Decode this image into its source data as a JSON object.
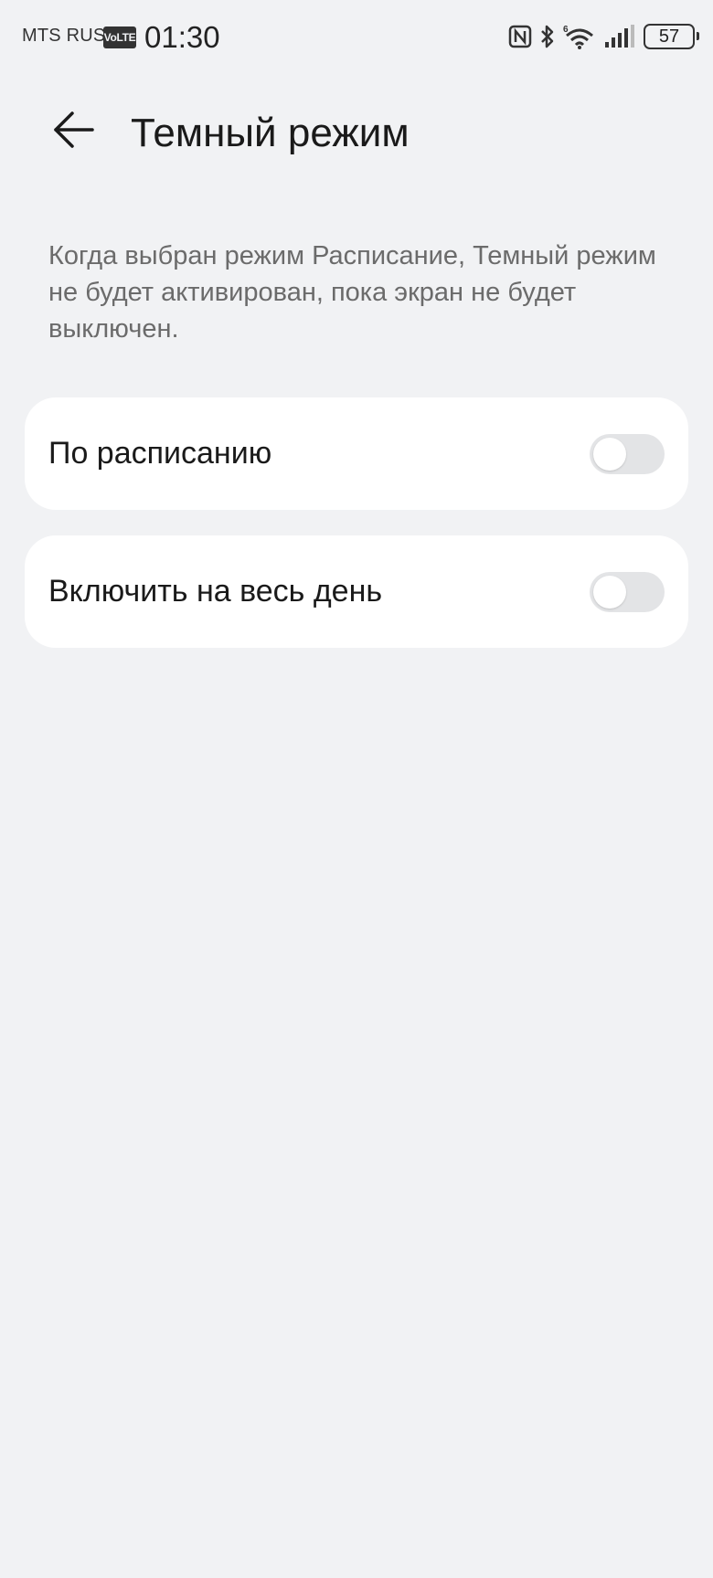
{
  "status_bar": {
    "carrier": "MTS RUS",
    "volte": "VoLTE",
    "time": "01:30",
    "battery_level": "57",
    "icons": [
      "nfc-icon",
      "bluetooth-icon",
      "wifi-6-icon",
      "signal-icon",
      "battery-icon"
    ]
  },
  "header": {
    "back_icon": "arrow-left-icon",
    "title": "Темный режим"
  },
  "description": "Когда выбран режим Расписание, Темный режим не будет активирован, пока экран не будет выключен.",
  "settings": [
    {
      "label": "По расписанию",
      "enabled": false
    },
    {
      "label": "Включить на весь день",
      "enabled": false
    }
  ],
  "colors": {
    "background": "#f1f2f4",
    "card": "#ffffff",
    "toggle_off": "#e3e4e6",
    "text_primary": "#1a1a1a",
    "text_secondary": "#6b6b6b"
  }
}
